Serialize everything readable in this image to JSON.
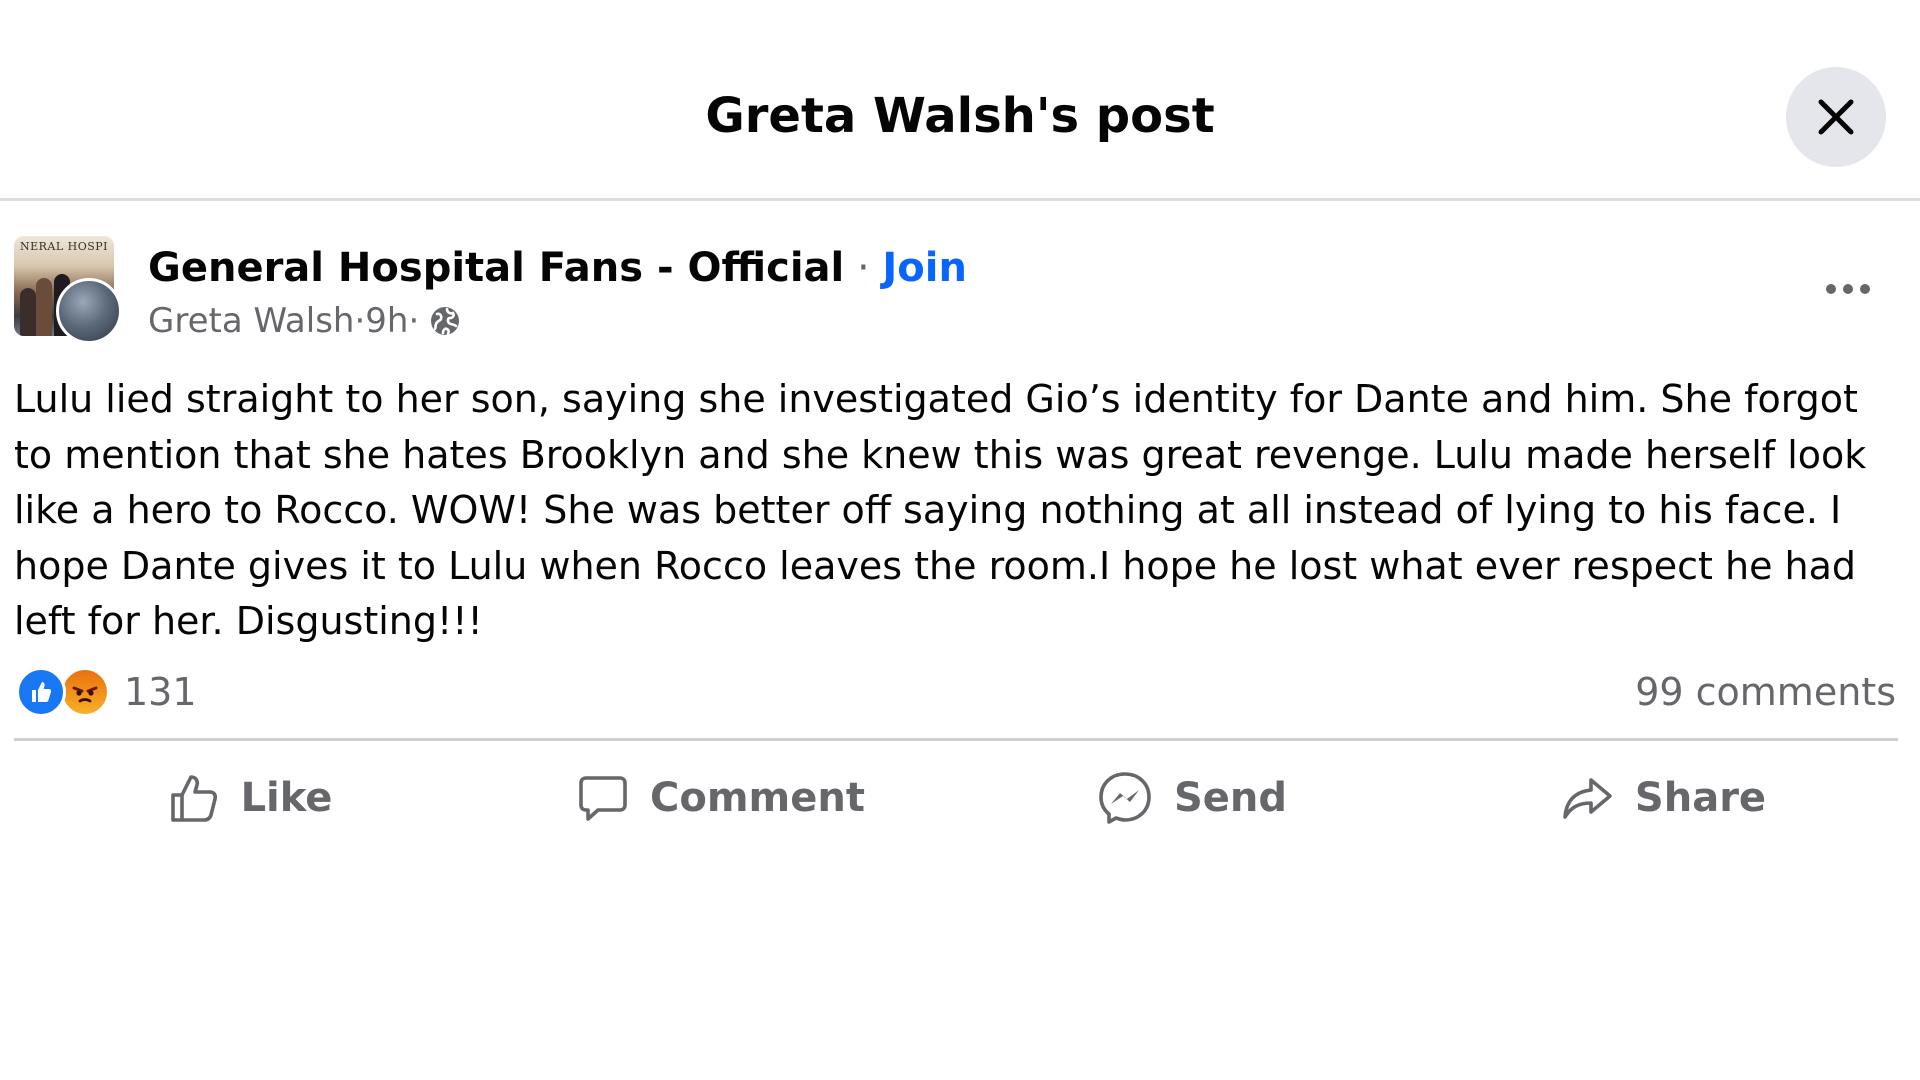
{
  "dialog": {
    "title": "Greta Walsh's post"
  },
  "post": {
    "group_avatar_caption": "NERAL HOSPI",
    "group_name": "General Hospital Fans - Official",
    "separator": " · ",
    "join_label": "Join",
    "author": "Greta Walsh",
    "time": "9h",
    "audience_icon": "globe-icon",
    "body": "Lulu lied straight to her son, saying she investigated Gio’s identity for Dante and him. She forgot to mention that she hates Brooklyn and she knew this was great revenge. Lulu made herself look like a hero to Rocco. WOW! She was better off saying nothing at all instead of lying to his face. I hope Dante gives it to Lulu when Rocco leaves the room.I hope he lost what ever respect he had left for her. Disgusting!!!",
    "reactions": {
      "icons": [
        "like-reaction-icon",
        "angry-reaction-icon"
      ],
      "count": "131"
    },
    "comments_label": "99 comments"
  },
  "actions": {
    "like": "Like",
    "comment": "Comment",
    "send": "Send",
    "share": "Share"
  },
  "colors": {
    "link_blue": "#0866ff",
    "secondary_text": "#65676b",
    "like_blue": "#1877f2",
    "close_button_bg": "#e4e6eb"
  }
}
